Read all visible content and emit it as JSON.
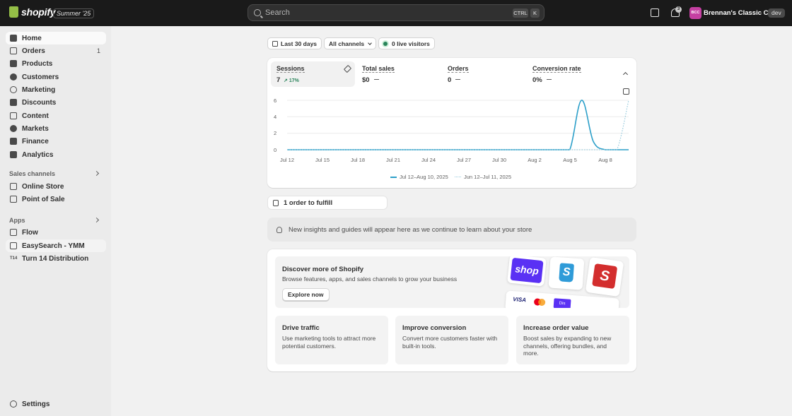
{
  "topbar": {
    "brand": "shopify",
    "edition": "Summer '25",
    "search_placeholder": "Search",
    "shortcut_ctrl": "CTRL",
    "shortcut_key": "K",
    "notification_count": "3",
    "avatar_initials": "BCC",
    "avatar_color": "#c540a2",
    "store_name": "Brennan's Classic Cars",
    "env_badge": "dev"
  },
  "sidebar": {
    "main_items": [
      {
        "label": "Home",
        "icon": "home-icon"
      },
      {
        "label": "Orders",
        "icon": "inbox-icon",
        "count": "1"
      },
      {
        "label": "Products",
        "icon": "tag-icon"
      },
      {
        "label": "Customers",
        "icon": "person-icon"
      },
      {
        "label": "Marketing",
        "icon": "target-icon"
      },
      {
        "label": "Discounts",
        "icon": "discount-icon"
      },
      {
        "label": "Content",
        "icon": "content-icon"
      },
      {
        "label": "Markets",
        "icon": "globe-icon"
      },
      {
        "label": "Finance",
        "icon": "bank-icon"
      },
      {
        "label": "Analytics",
        "icon": "chart-icon"
      }
    ],
    "sales_channels_heading": "Sales channels",
    "sales_channels": [
      {
        "label": "Online Store",
        "icon": "store-icon"
      },
      {
        "label": "Point of Sale",
        "icon": "pos-icon"
      }
    ],
    "apps_heading": "Apps",
    "apps": [
      {
        "label": "Flow",
        "icon": "flow-icon"
      },
      {
        "label": "EasySearch - YMM",
        "icon": "easysearch-icon"
      },
      {
        "label": "Turn 14 Distribution",
        "icon": "turn14-icon",
        "mark": "T14"
      }
    ],
    "settings_label": "Settings"
  },
  "filters": {
    "date_range": "Last 30 days",
    "channels": "All channels",
    "live_visitors": "0 live visitors"
  },
  "metrics": [
    {
      "title": "Sessions",
      "value": "7",
      "change": "17%"
    },
    {
      "title": "Total sales",
      "value": "$0"
    },
    {
      "title": "Orders",
      "value": "0"
    },
    {
      "title": "Conversion rate",
      "value": "0%"
    }
  ],
  "chart_data": {
    "type": "line",
    "y_ticks": [
      "0",
      "2",
      "4",
      "6"
    ],
    "ylim": [
      0,
      6
    ],
    "x_ticks": [
      "Jul 12",
      "Jul 15",
      "Jul 18",
      "Jul 21",
      "Jul 24",
      "Jul 27",
      "Jul 30",
      "Aug 2",
      "Aug 5",
      "Aug 8"
    ],
    "series": [
      {
        "name": "Jul 12–Aug 10, 2025",
        "color": "#2c9fc9",
        "style": "solid",
        "x": [
          "Jul 12",
          "Jul 13",
          "Jul 14",
          "Jul 15",
          "Jul 16",
          "Jul 17",
          "Jul 18",
          "Jul 19",
          "Jul 20",
          "Jul 21",
          "Jul 22",
          "Jul 23",
          "Jul 24",
          "Jul 25",
          "Jul 26",
          "Jul 27",
          "Jul 28",
          "Jul 29",
          "Jul 30",
          "Jul 31",
          "Aug 1",
          "Aug 2",
          "Aug 3",
          "Aug 4",
          "Aug 5",
          "Aug 6",
          "Aug 7",
          "Aug 8",
          "Aug 9",
          "Aug 10"
        ],
        "values": [
          0,
          0,
          0,
          0,
          0,
          0,
          0,
          0,
          0,
          0,
          0,
          0,
          0,
          0,
          0,
          0,
          0,
          0,
          0,
          0,
          0,
          0,
          0,
          0,
          0,
          6,
          1,
          0,
          0,
          0
        ]
      },
      {
        "name": "Jun 12–Jul 11, 2025",
        "color": "#93c9dc",
        "style": "dotted",
        "x": [
          "Jul 12",
          "Jul 13",
          "Jul 14",
          "Jul 15",
          "Jul 16",
          "Jul 17",
          "Jul 18",
          "Jul 19",
          "Jul 20",
          "Jul 21",
          "Jul 22",
          "Jul 23",
          "Jul 24",
          "Jul 25",
          "Jul 26",
          "Jul 27",
          "Jul 28",
          "Jul 29",
          "Jul 30",
          "Jul 31",
          "Aug 1",
          "Aug 2",
          "Aug 3",
          "Aug 4",
          "Aug 5",
          "Aug 6",
          "Aug 7",
          "Aug 8",
          "Aug 9",
          "Aug 10"
        ],
        "values": [
          0,
          0,
          0,
          0,
          0,
          0,
          0,
          0,
          0,
          0,
          0,
          0,
          0,
          0,
          0,
          0,
          0,
          0,
          0,
          0,
          0,
          0,
          0,
          0,
          0,
          0,
          0,
          0,
          0,
          6
        ]
      }
    ]
  },
  "fulfill": {
    "label": "1 order to fulfill"
  },
  "insight": {
    "text": "New insights and guides will appear here as we continue to learn about your store"
  },
  "discover": {
    "title": "Discover more of Shopify",
    "subtitle": "Browse features, apps, and sales channels to grow your business",
    "button": "Explore now",
    "tile_shop_label": "shop",
    "tile_bag_label": "S",
    "tile_s_label": "S",
    "pay_visa": "VISA",
    "pay_other": "Dis"
  },
  "tips": [
    {
      "title": "Drive traffic",
      "text": "Use marketing tools to attract more potential customers."
    },
    {
      "title": "Improve conversion",
      "text": "Convert more customers faster with built-in tools."
    },
    {
      "title": "Increase order value",
      "text": "Boost sales by expanding to new channels, offering bundles, and more."
    }
  ]
}
